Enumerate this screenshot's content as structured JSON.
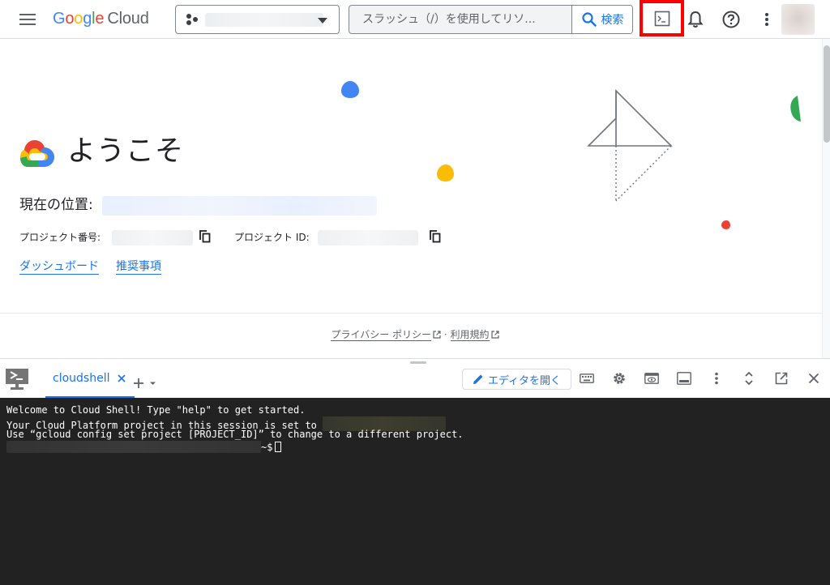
{
  "topbar": {
    "logo_letters": [
      "G",
      "o",
      "o",
      "g",
      "l",
      "e"
    ],
    "logo_suffix": "Cloud",
    "search_placeholder": "スラッシュ（/）を使用してリソ...",
    "search_button_label": "検索"
  },
  "welcome": {
    "title": "ようこそ",
    "location_label": "現在の位置:",
    "project_number_label": "プロジェクト番号:",
    "project_id_label": "プロジェクト ID:",
    "links": {
      "dashboard": "ダッシュボード",
      "recommendations": "推奨事項"
    }
  },
  "footer": {
    "privacy": "プライバシー ポリシー",
    "separator": "·",
    "terms": "利用規約"
  },
  "shell": {
    "tab_label": "cloudshell",
    "open_editor_label": "エディタを開く",
    "terminal_lines": {
      "line1": "Welcome to Cloud Shell! Type \"help\" to get started.",
      "line2": "Your Cloud Platform project in this session is set to ",
      "line3": "Use “gcloud config set project [PROJECT_ID]” to change to a different project.",
      "prompt": "~$"
    }
  },
  "colors": {
    "google_blue": "#4285f4",
    "google_red": "#ea4335",
    "google_yellow": "#fbbc04",
    "google_green": "#34a853",
    "link_blue": "#1a73e8",
    "highlight_border": "#ff0000",
    "terminal_bg": "#222222"
  },
  "icons": {
    "menu": "hamburger-icon",
    "project": "project-dots-icon",
    "search": "search-icon",
    "shell": "terminal-icon",
    "notifications": "bell-icon",
    "help": "help-icon",
    "more": "more-vert-icon",
    "copy": "copy-icon",
    "external": "external-link-icon",
    "keyboard": "keyboard-icon",
    "settings": "gear-icon",
    "web_preview": "web-preview-icon",
    "minimize": "minimize-icon",
    "expand": "expand-icon",
    "new_window": "open-in-new-icon",
    "close": "close-icon",
    "pencil": "pencil-icon",
    "add": "plus-icon"
  }
}
